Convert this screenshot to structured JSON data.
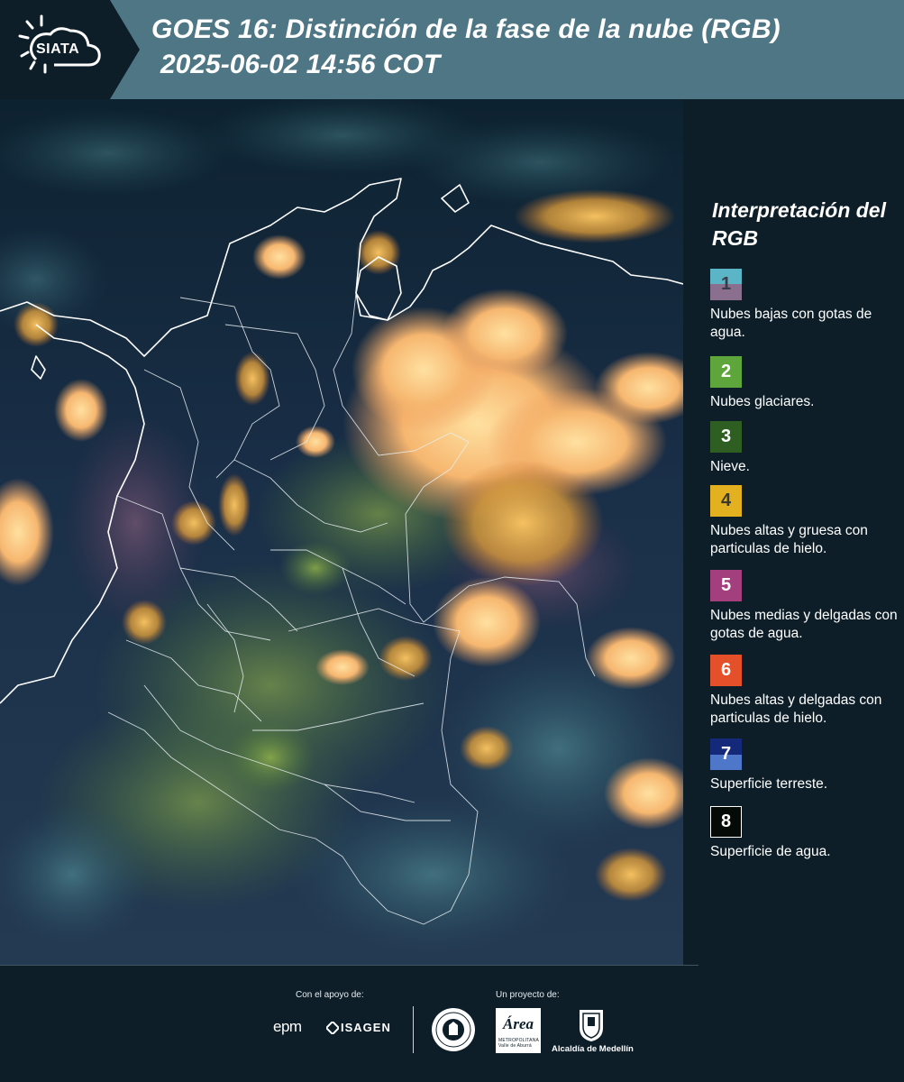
{
  "header": {
    "logo_text": "SIATA",
    "title": "GOES 16: Distinción de la fase de la nube (RGB)",
    "datetime": "2025-06-02 14:56 COT"
  },
  "colors": {
    "header_bg": "#4e7685",
    "logo_bg": "#0d1e28",
    "panel_bg": "#0d1e28",
    "border_white": "#ffffff"
  },
  "legend": {
    "title": "Interpretación del RGB",
    "items": [
      {
        "num": "1",
        "label": "Nubes bajas con gotas de agua.",
        "colors": [
          "#5bb5c6",
          "#8a6f8f"
        ],
        "num_color": "#3a3a48"
      },
      {
        "num": "2",
        "label": "Nubes glaciares.",
        "colors": [
          "#5ea63b"
        ],
        "num_color": "#ffffff"
      },
      {
        "num": "3",
        "label": "Nieve.",
        "colors": [
          "#2e5e22"
        ],
        "num_color": "#ffffff"
      },
      {
        "num": "4",
        "label": "Nubes altas y gruesa con particulas de hielo.",
        "colors": [
          "#e3b020"
        ],
        "num_color": "#3a3a28"
      },
      {
        "num": "5",
        "label": "Nubes medias y delgadas con gotas de agua.",
        "colors": [
          "#a33f7c"
        ],
        "num_color": "#ffffff"
      },
      {
        "num": "6",
        "label": "Nubes altas y delgadas con particulas de hielo.",
        "colors": [
          "#e4502a"
        ],
        "num_color": "#ffffff"
      },
      {
        "num": "7",
        "label": "Superficie terreste.",
        "colors": [
          "#15297a",
          "#4f77c9"
        ],
        "num_color": "#ffffff"
      },
      {
        "num": "8",
        "label": "Superficie de agua.",
        "colors": [
          "#060a06"
        ],
        "num_color": "#ffffff",
        "border": true
      }
    ]
  },
  "footer": {
    "support_label": "Con el apoyo de:",
    "project_label": "Un proyecto de:",
    "sponsors": [
      "epm",
      "ISAGEN"
    ],
    "area_logo_word": "Área",
    "area_logo_sub": "METROPOLITANA Valle de Aburrá",
    "alcaldia": "Alcaldía de Medellín"
  }
}
